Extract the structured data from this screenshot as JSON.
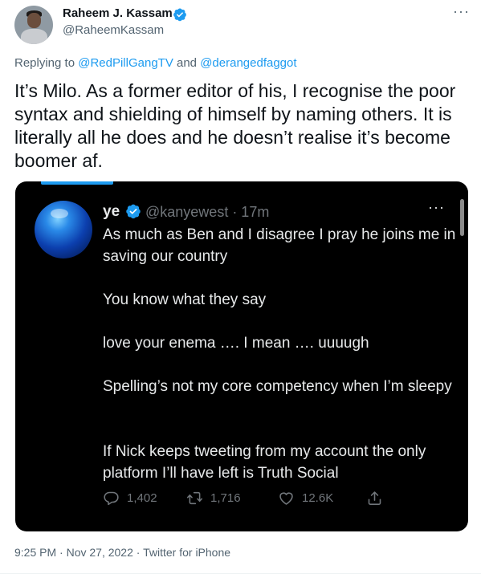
{
  "tweet": {
    "author_name": "Raheem J. Kassam",
    "author_handle": "@RaheemKassam",
    "more_label": "···",
    "replying_prefix": "Replying to",
    "replying_user1": "@RedPillGangTV",
    "replying_and": "and",
    "replying_user2": "@derangedfaggot",
    "text": "It’s Milo. As a former editor of his, I recognise the poor syntax and shielding of himself by naming others. It is literally all he does and he doesn’t realise it’s become boomer af.",
    "time": "9:25 PM",
    "date": "Nov 27, 2022",
    "source": "Twitter for iPhone",
    "separator": "·"
  },
  "embedded": {
    "author_name": "ye",
    "author_handle": "@kanyewest · 17m",
    "more_label": "···",
    "paragraphs": [
      "As much as Ben and I disagree I pray he joins me in saving our country",
      "You know what they say",
      "love your enema …. I mean …. uuuugh",
      "Spelling’s not my core competency when I’m sleepy",
      "If Nick keeps tweeting from my account the only platform I’ll have left is Truth Social"
    ],
    "replies": "1,402",
    "retweets": "1,716",
    "likes": "12.6K"
  },
  "colors": {
    "accent": "#1d9bf0",
    "secondary_text": "#536471",
    "dark_bg": "#000000",
    "dark_text": "#e7e9ea"
  },
  "icons": [
    "verified-badge-icon",
    "more-icon",
    "reply-icon",
    "retweet-icon",
    "like-icon",
    "share-icon"
  ]
}
